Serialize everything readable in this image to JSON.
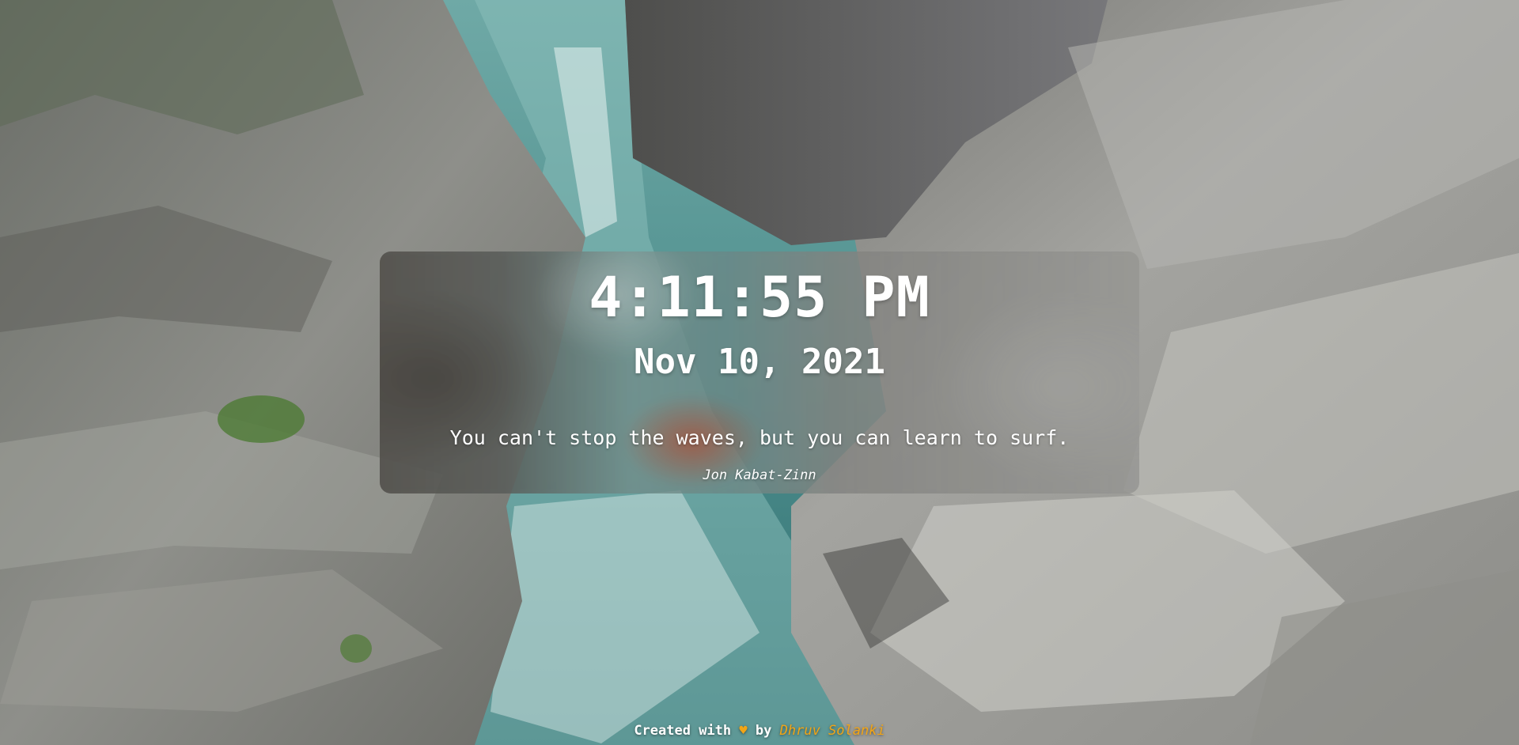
{
  "clock": {
    "time": "4:11:55 PM",
    "date": "Nov 10, 2021"
  },
  "quote": {
    "text": "You can't stop the waves, but you can learn to surf.",
    "author": "Jon Kabat-Zinn"
  },
  "footer": {
    "prefix": "Created with",
    "heart": "♥",
    "by": "by",
    "author_link": "Dhruv Solanki"
  },
  "colors": {
    "text": "#ffffff",
    "accent": "#f2a516",
    "card_tint": "rgba(90,90,90,0.25)"
  },
  "background": {
    "scene": "rocky canyon with turquoise river"
  }
}
